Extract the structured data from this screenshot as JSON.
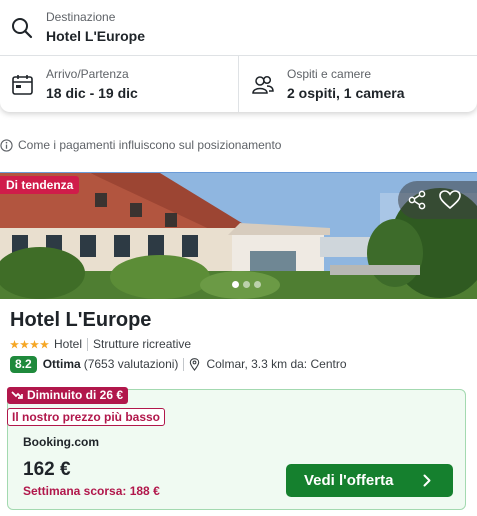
{
  "search": {
    "destination_label": "Destinazione",
    "destination_value": "Hotel L'Europe",
    "dates_label": "Arrivo/Partenza",
    "dates_value": "18 dic - 19 dic",
    "guests_label": "Ospiti e camere",
    "guests_value": "2 ospiti, 1 camera",
    "icons": [
      "search-icon",
      "calendar-icon",
      "guests-icon"
    ]
  },
  "info": {
    "text": "Come i pagamenti influiscono sul posizionamento",
    "icon": "info-icon"
  },
  "hotel": {
    "trend_badge": "Di tendenza",
    "name": "Hotel L'Europe",
    "stars": 4,
    "type": "Hotel",
    "category": "Strutture ricreative",
    "score": "8.2",
    "rating_word": "Ottima",
    "reviews": "(7653 valutazioni)",
    "location": "Colmar, 3.3 km da: Centro",
    "carousel": {
      "count": 3,
      "active": 0
    },
    "image_actions": [
      "share-icon",
      "heart-icon"
    ]
  },
  "deal": {
    "drop_badge": "Diminuito di 26 €",
    "best_badge": "Il nostro prezzo più basso",
    "provider": "Booking.com",
    "price": "162 €",
    "last_week": "Settimana scorsa: 188 €",
    "button": "Vedi l'offerta"
  },
  "colors": {
    "trend": "#d01c4a",
    "price_drop": "#b1174b",
    "score": "#1f8a3c",
    "button": "#15802e",
    "deal_bg": "#f0faf2"
  }
}
